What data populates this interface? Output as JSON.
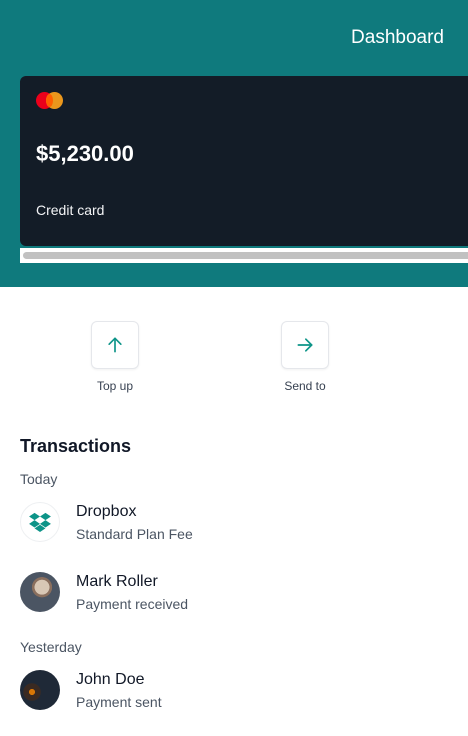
{
  "header": {
    "title": "Dashboard"
  },
  "card": {
    "brand_icon": "mastercard-logo",
    "balance": "$5,230.00",
    "type": "Credit card"
  },
  "actions": [
    {
      "label": "Top up",
      "icon": "arrow-up-icon"
    },
    {
      "label": "Send to",
      "icon": "arrow-right-icon"
    }
  ],
  "transactions": {
    "title": "Transactions",
    "groups": [
      {
        "label": "Today",
        "items": [
          {
            "name": "Dropbox",
            "description": "Standard Plan Fee",
            "avatar": "dropbox-logo"
          },
          {
            "name": "Mark Roller",
            "description": "Payment received",
            "avatar": "photo"
          }
        ]
      },
      {
        "label": "Yesterday",
        "items": [
          {
            "name": "John Doe",
            "description": "Payment sent",
            "avatar": "photo"
          }
        ]
      }
    ]
  },
  "colors": {
    "header_bg": "#0f7a7d",
    "card_bg": "#131c27",
    "accent": "#0d9488"
  }
}
